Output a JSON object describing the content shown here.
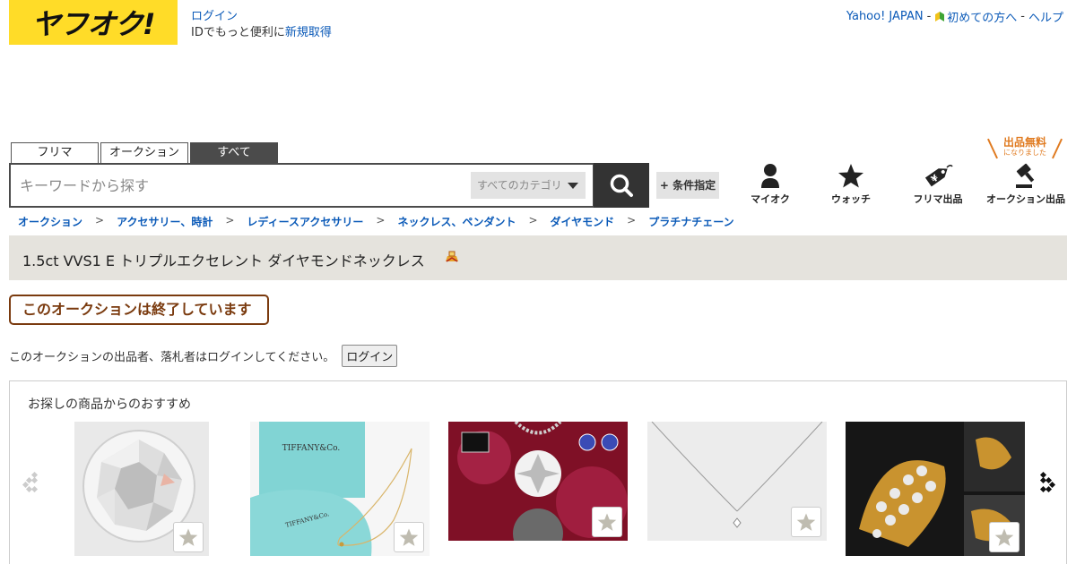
{
  "header": {
    "logo_text": "ヤフオク!",
    "login_label": "ログイン",
    "id_note_prefix": "IDでもっと便利に",
    "signup_label": "新規取得",
    "top_links": {
      "yahoo": "Yahoo! JAPAN",
      "beginner": "初めての方へ",
      "help": "ヘルプ",
      "separator": "-"
    }
  },
  "search": {
    "tabs": [
      {
        "label": "フリマ",
        "active": false
      },
      {
        "label": "オークション",
        "active": false
      },
      {
        "label": "すべて",
        "active": true
      }
    ],
    "placeholder": "キーワードから探す",
    "category_label": "すべてのカテゴリ",
    "conditions_label": "+ 条件指定"
  },
  "nav_icons": {
    "free_badge_big": "出品無料",
    "free_badge_small": "になりました",
    "items": [
      {
        "label": "マイオク",
        "icon": "person-icon"
      },
      {
        "label": "ウォッチ",
        "icon": "star-icon"
      },
      {
        "label": "フリマ出品",
        "icon": "price-tag-icon"
      },
      {
        "label": "オークション出品",
        "icon": "gavel-icon"
      }
    ]
  },
  "breadcrumb": [
    "オークション",
    "アクセサリー、時計",
    "レディースアクセサリー",
    "ネックレス、ペンダント",
    "ダイヤモンド",
    "プラチナチェーン"
  ],
  "breadcrumb_separator": ">",
  "item": {
    "title": "1.5ct VVS1 E トリプルエクセレント ダイヤモンドネックレス",
    "ended_message": "このオークションは終了しています",
    "login_note": "このオークションの出品者、落札者はログインしてください。",
    "login_button": "ログイン"
  },
  "recommendations": {
    "title": "お探しの商品からのおすすめ",
    "items": [
      {
        "image": "loose-diamond",
        "bg": "#eaeaea"
      },
      {
        "image": "tiffany-box-necklace",
        "bg": "#7dd0d3"
      },
      {
        "image": "diamond-pendant-red",
        "bg": "#8c1530"
      },
      {
        "image": "platinum-chain-necklace",
        "bg": "#eeeeee"
      },
      {
        "image": "gold-diamond-ring",
        "bg": "#1b1b1b"
      }
    ]
  },
  "colors": {
    "logo_bg": "#ffdc28",
    "link": "#0b5ab8",
    "ended_border": "#7a3a0e",
    "free_badge": "#e07a1f"
  }
}
